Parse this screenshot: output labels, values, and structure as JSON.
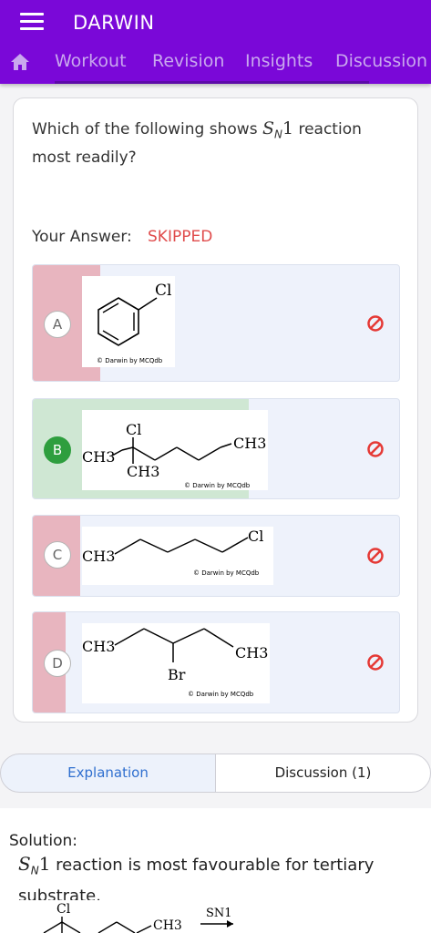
{
  "header": {
    "app_title": "DARWIN",
    "tabs": [
      {
        "label": "Workout"
      },
      {
        "label": "Revision"
      },
      {
        "label": "Insights"
      },
      {
        "label": "Discussion"
      }
    ],
    "colors": {
      "bar": "#7a08d8",
      "tab_text": "#c9a8ee"
    }
  },
  "question": {
    "prefix": "Which of the following shows ",
    "reaction_symbol": "S",
    "reaction_subscript": "N",
    "reaction_order": "1",
    "suffix": " reaction most readily?"
  },
  "answer": {
    "label": "Your Answer:",
    "value": "SKIPPED",
    "value_color": "#e04b4b"
  },
  "options": [
    {
      "letter": "A",
      "status_icon": "ban-icon",
      "fill_color": "#e8b5bf",
      "structure_labels": {
        "atom1": "Cl"
      },
      "watermark": "© Darwin by MCQdb"
    },
    {
      "letter": "B",
      "status_icon": "ban-icon",
      "fill_color": "#cfe7d3",
      "selected_marker_color": "#2e9e3e",
      "structure_labels": {
        "top": "Cl",
        "left": "CH3",
        "bottom": "CH3",
        "right": "CH3"
      },
      "watermark": "© Darwin by MCQdb"
    },
    {
      "letter": "C",
      "status_icon": "ban-icon",
      "fill_color": "#e8b5bf",
      "structure_labels": {
        "left": "CH3",
        "right": "Cl"
      },
      "watermark": "© Darwin by MCQdb"
    },
    {
      "letter": "D",
      "status_icon": "ban-icon",
      "fill_color": "#e8b5bf",
      "structure_labels": {
        "left": "CH3",
        "right": "CH3",
        "bottom": "Br"
      },
      "watermark": "© Darwin by MCQdb"
    }
  ],
  "segments": {
    "explanation": "Explanation",
    "discussion": "Discussion (1)"
  },
  "solution": {
    "title": "Solution:",
    "symbol": "S",
    "subscript": "N",
    "order": "1",
    "text": " reaction is most favourable for tertiary substrate.",
    "image_labels": {
      "cl": "Cl",
      "ch3": "CH3",
      "arrow_label": "SN1"
    }
  }
}
